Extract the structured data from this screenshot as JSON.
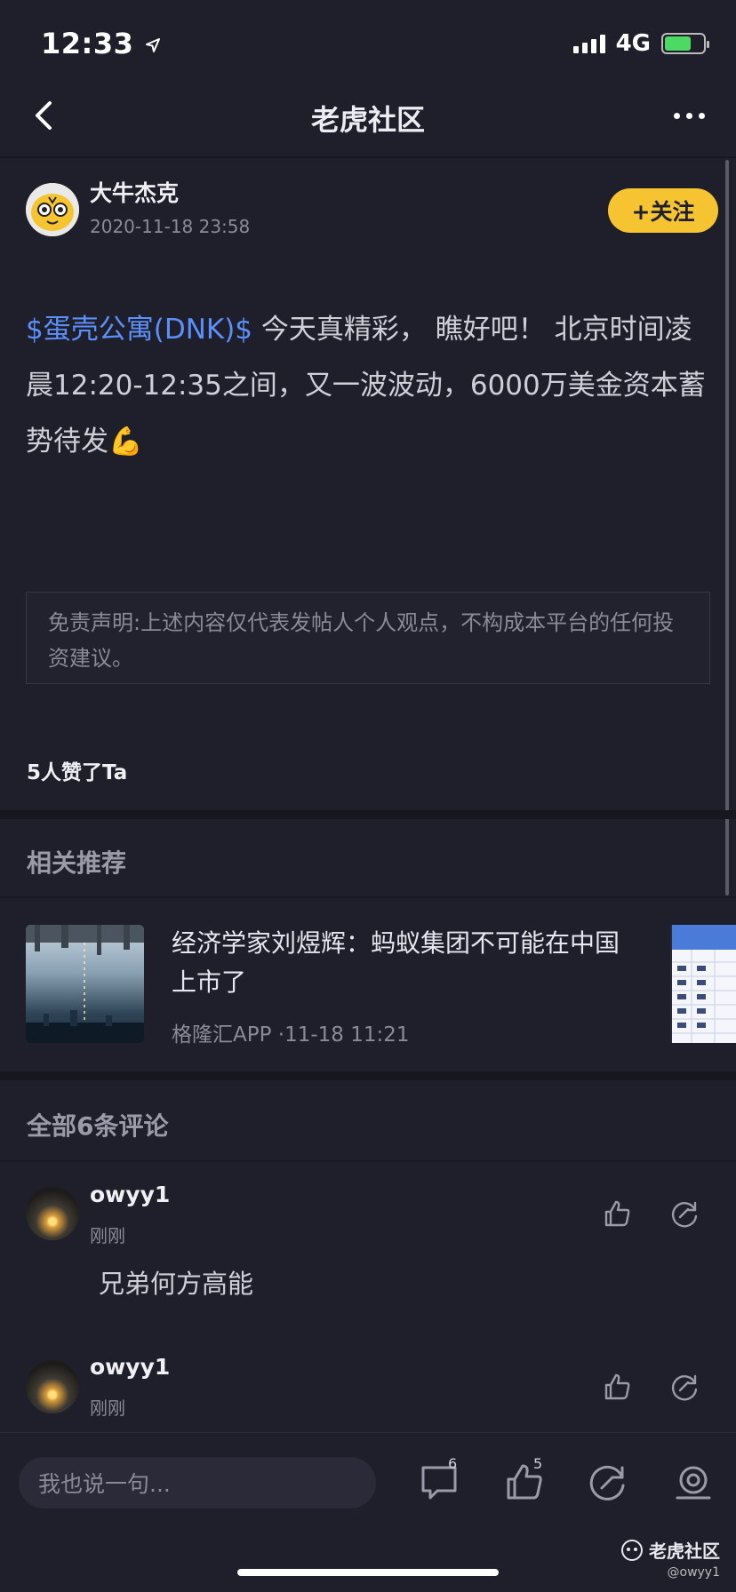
{
  "status_bar": {
    "time": "12:33",
    "network": "4G"
  },
  "nav": {
    "title": "老虎社区"
  },
  "author": {
    "name": "大牛杰克",
    "time": "2020-11-18 23:58",
    "follow_label": "+关注"
  },
  "post": {
    "ticker": "$蛋壳公寓(DNK)$",
    "text": " 今天真精彩， 瞧好吧！ 北京时间凌晨12:20-12:35之间，又一波波动，6000万美金资本蓄势待发",
    "emoji": "💪"
  },
  "disclaimer": "免责声明:上述内容仅代表发帖人个人观点，不构成本平台的任何投资建议。",
  "likes_text": "5人赞了Ta",
  "related": {
    "title": "相关推荐",
    "items": [
      {
        "title": "经济学家刘煜辉：蚂蚁集团不可能在中国上市了",
        "source": "格隆汇APP",
        "time": "·11-18 11:21"
      }
    ]
  },
  "comments_section": {
    "title": "全部6条评论",
    "items": [
      {
        "user": "owyy1",
        "time": "刚刚",
        "text": "兄弟何方高能"
      },
      {
        "user": "owyy1",
        "time": "刚刚",
        "text": ""
      }
    ]
  },
  "bottom_bar": {
    "input_placeholder": "我也说一句...",
    "comment_count": "6",
    "like_count": "5"
  },
  "watermark": {
    "brand": "老虎社区",
    "user": "@owyy1"
  },
  "colors": {
    "background": "#1f1f2b",
    "accent_blue": "#5b8ff9",
    "follow_yellow": "#f6c431"
  }
}
